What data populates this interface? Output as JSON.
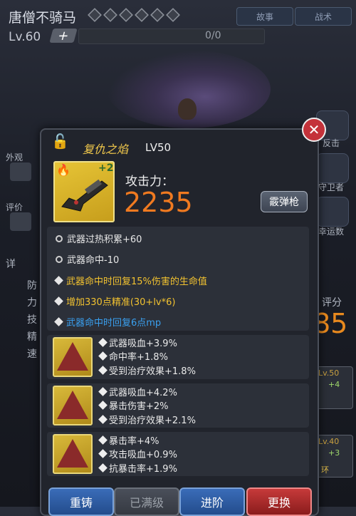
{
  "header": {
    "hero_name": "唐僧不骑马",
    "level": "Lv.60",
    "exp": "0/0",
    "tab_story": "故事",
    "tab_battle": "战术"
  },
  "left_sidebar": {
    "appearance": "外观",
    "review": "评价",
    "detail": "详",
    "stat_defense": "防",
    "stat_power": "力",
    "stat_skill": "技",
    "stat_spirit": "精",
    "stat_speed": "速"
  },
  "right_sidebar": {
    "counter": "反击",
    "guardian": "守卫者",
    "lucky": "幸运数",
    "score_label": "评分",
    "score_value": "85",
    "slot1_lv": "Lv.50",
    "slot1_plus": "+4",
    "slot2_lv": "Lv.40",
    "slot2_plus": "+3",
    "slot2_tag": "环"
  },
  "popup": {
    "weapon_name": "复仇之焰",
    "weapon_level": "LV50",
    "upgrade_level": "+2",
    "attack_label": "攻击力：",
    "attack_value": "2235",
    "weapon_type": "霰弹枪",
    "attributes": [
      {
        "text": "武器过热积累+60",
        "color": "#e8e8e8",
        "bullet": "gear"
      },
      {
        "text": "武器命中-10",
        "color": "#e8e8e8",
        "bullet": "gear"
      },
      {
        "text": "武器命中时回复15%伤害的生命值",
        "color": "#f2c230",
        "bullet": "diamond"
      },
      {
        "text": "增加330点精准(30+lv*6)",
        "color": "#f2c230",
        "bullet": "diamond"
      },
      {
        "text": "武器命中时回复6点mp",
        "color": "#3aa0f0",
        "bullet": "diamond"
      }
    ],
    "gems": [
      {
        "lines": [
          "武器吸血+3.9%",
          "命中率+1.8%",
          "受到治疗效果+1.8%"
        ]
      },
      {
        "lines": [
          "武器吸血+4.2%",
          "暴击伤害+2%",
          "受到治疗效果+2.1%"
        ]
      },
      {
        "lines": [
          "暴击率+4%",
          "攻击吸血+0.9%",
          "抗暴击率+1.9%"
        ]
      }
    ],
    "buttons": {
      "recast": "重铸",
      "maxed": "已满级",
      "advance": "进阶",
      "replace": "更换"
    }
  }
}
